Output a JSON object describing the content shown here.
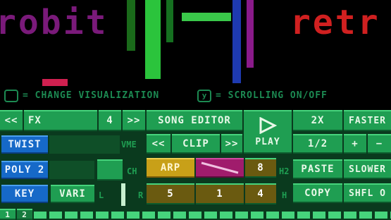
{
  "viz": {
    "word_left": "robit",
    "word_right": "retr",
    "hint_change_key": "",
    "hint_change": "= CHANGE VISUALIZATION",
    "hint_scroll_key": "y",
    "hint_scroll": "= SCROLLING ON/OFF"
  },
  "colors": {
    "panel": "#0a3a1e",
    "button": "#1f9e52",
    "accent_blue": "#1669c8",
    "accent_yellow": "#c8a018",
    "accent_magenta": "#a01c6c"
  },
  "row1": {
    "prev": "<<",
    "fx": "FX",
    "fx_value": "4",
    "next": ">>",
    "song_editor": "SONG EDITOR",
    "play_icon": "play-icon",
    "speed": "2X",
    "faster": "FASTER"
  },
  "row2": {
    "twist": "TWIST",
    "vol_label": "VME",
    "clip_prev": "<<",
    "clip": "CLIP",
    "clip_next": ">>",
    "play": "PLAY",
    "half": "1/2",
    "plus": "+",
    "minus": "−"
  },
  "row3": {
    "poly": "POLY 2",
    "ch_label": "CH",
    "arp": "ARP",
    "arp_value": "8",
    "h2_label": "H2",
    "paste": "PASTE",
    "slower": "SLOWER"
  },
  "row4": {
    "key": "KEY",
    "vari": "VARI",
    "l_label": "L",
    "r_label": "R",
    "val1": "5",
    "val2": "1",
    "val3": "4",
    "h_label": "H",
    "copy": "COPY",
    "shfl": "SHFL O"
  },
  "bottom": {
    "first": "1",
    "second": "2"
  }
}
